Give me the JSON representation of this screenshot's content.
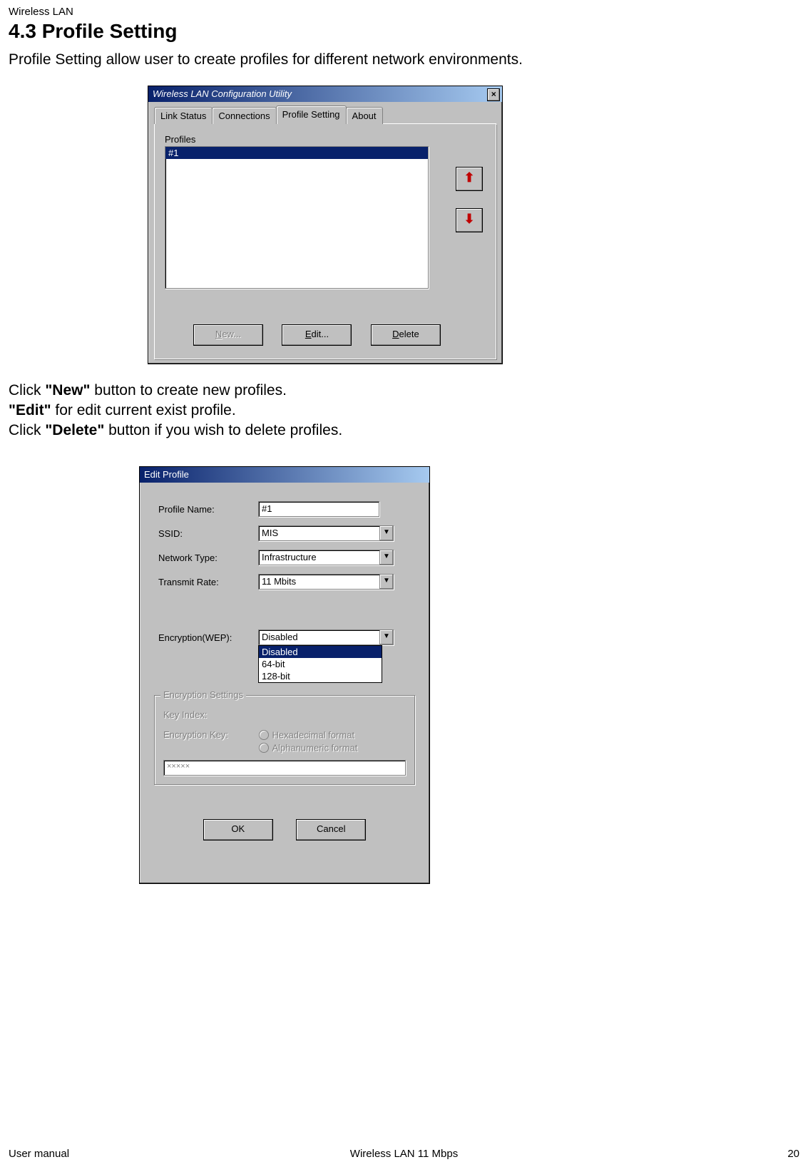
{
  "doc": {
    "header": "Wireless LAN",
    "section_title": "4.3 Profile Setting",
    "intro": "Profile Setting allow user to create profiles for different network environments.",
    "mid_line1_a": "Click ",
    "mid_line1_b": "\"New\"",
    "mid_line1_c": " button to create new profiles.",
    "mid_line2_a": "\"Edit\"",
    "mid_line2_b": " for edit current exist profile.",
    "mid_line3_a": "Click ",
    "mid_line3_b": "\"Delete\"",
    "mid_line3_c": " button if you wish to delete profiles.",
    "footer_left": "User manual",
    "footer_center": "Wireless LAN 11 Mbps",
    "footer_right": "20"
  },
  "dlg1": {
    "title": "Wireless LAN Configuration Utility",
    "close": "×",
    "tabs": {
      "link_status": "Link Status",
      "connections": "Connections",
      "profile_setting": "Profile Setting",
      "about": "About"
    },
    "profiles_label": "Profiles",
    "profile_item": "#1",
    "arrow_up": "⬆",
    "arrow_down": "⬇",
    "btn_new_u": "N",
    "btn_new_rest": "ew...",
    "btn_edit_u": "E",
    "btn_edit_rest": "dit...",
    "btn_delete_u": "D",
    "btn_delete_rest": "elete"
  },
  "dlg2": {
    "title": "Edit Profile",
    "labels": {
      "profile_name": "Profile Name:",
      "ssid": "SSID:",
      "network_type": "Network Type:",
      "transmit_rate": "Transmit Rate:",
      "encryption": "Encryption(WEP):",
      "group_title": "Encryption Settings",
      "key_index": "Key Index:",
      "encryption_key": "Encryption Key:",
      "hex": "Hexadecimal format",
      "alpha": "Alphanumeric format"
    },
    "values": {
      "profile_name": "#1",
      "ssid": "MIS",
      "network_type": "Infrastructure",
      "transmit_rate": "11 Mbits",
      "encryption": "Disabled",
      "key_value": "×××××"
    },
    "wep_options": {
      "disabled": "Disabled",
      "b64": "64-bit",
      "b128": "128-bit"
    },
    "dd_arrow": "▼",
    "ok": "OK",
    "cancel": "Cancel"
  }
}
